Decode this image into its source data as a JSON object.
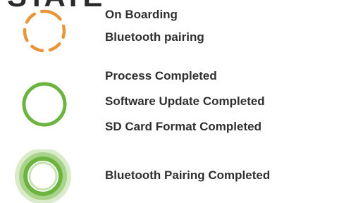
{
  "heading_fragment": "STATE",
  "legend": [
    {
      "icon": "dashed-orange-circle-icon",
      "color": "#E8953A",
      "labels": [
        "On Boarding",
        "Bluetooth pairing"
      ]
    },
    {
      "icon": "solid-green-ring-icon",
      "color": "#6DB33F",
      "labels": [
        "Process Completed",
        "Software Update Completed",
        "SD Card Format Completed"
      ]
    },
    {
      "icon": "glowing-green-ring-icon",
      "color": "#6DB33F",
      "labels": [
        "Bluetooth Pairing Completed"
      ]
    }
  ]
}
